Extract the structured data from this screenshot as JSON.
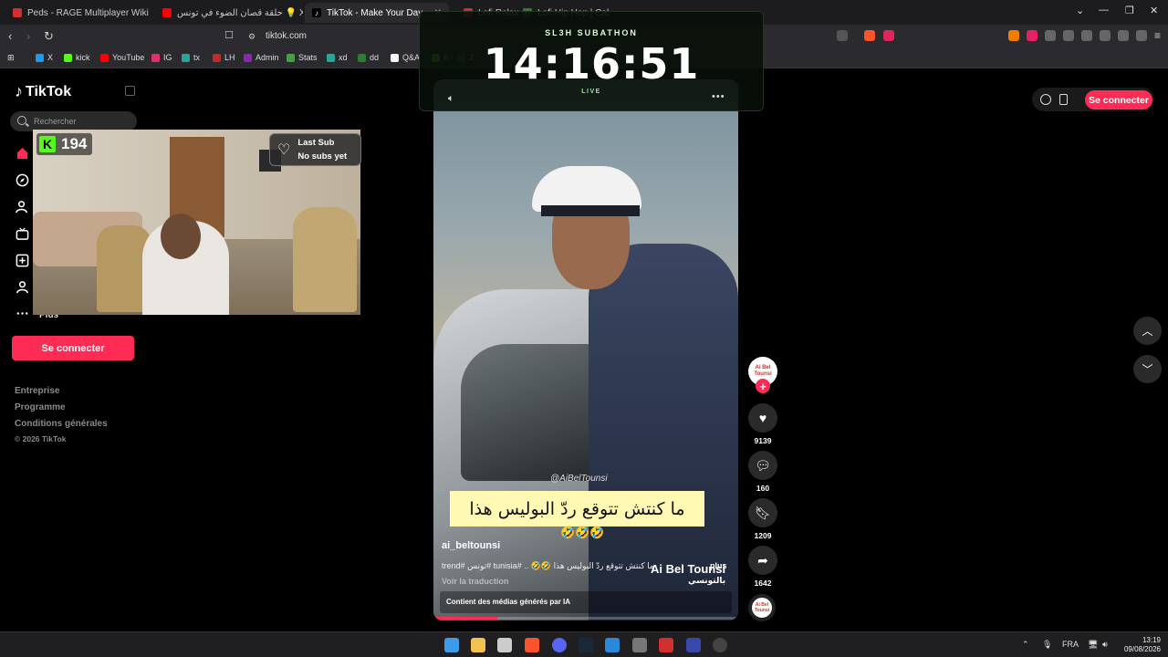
{
  "browser": {
    "tabs": [
      {
        "title": "Peds - RAGE Multiplayer Wiki",
        "favicon_color": "#d32f2f"
      },
      {
        "title": "حلقة قصان الضوء في تونس 💡 X",
        "favicon_color": "#ff0000"
      },
      {
        "title": "TikTok - Make Your Day",
        "favicon_color": "#000000"
      },
      {
        "title": "Lofi Relax",
        "favicon_color": "#d32f2f"
      },
      {
        "title": "Lofi Hip Hop | Cal",
        "favicon_color": "#2e7d32"
      }
    ],
    "active_tab_index": 2,
    "url": "tiktok.com",
    "bookmarks": [
      {
        "label": "X",
        "color": "#1d9bf0"
      },
      {
        "label": "kick",
        "color": "#53fc18"
      },
      {
        "label": "YouTube",
        "color": "#ff0000"
      },
      {
        "label": "IG",
        "color": "#e1306c"
      },
      {
        "label": "tx",
        "color": "#26a69a"
      },
      {
        "label": "LH",
        "color": "#c62828"
      },
      {
        "label": "Admin",
        "color": "#8e24aa"
      },
      {
        "label": "Stats",
        "color": "#43a047"
      },
      {
        "label": "xd",
        "color": "#26a69a"
      },
      {
        "label": "dd",
        "color": "#2e7d32"
      },
      {
        "label": "Q&A",
        "color": "#f5f5f5"
      },
      {
        "label": "K",
        "color": "#53fc18"
      },
      {
        "label": "2",
        "color": "#2e7d32"
      }
    ]
  },
  "tiktok": {
    "logo_text": "TikTok",
    "search_placeholder": "Rechercher",
    "more_label": "Plus",
    "login_button": "Se connecter",
    "footer_links": [
      "Entreprise",
      "Programme",
      "Conditions générales"
    ],
    "copyright": "© 2026 TikTok",
    "top_right_login": "Se connecter"
  },
  "stream_overlay": {
    "kick_count": "194",
    "last_sub_title": "Last Sub",
    "last_sub_value": "No subs yet",
    "subathon_title": "SL3H SUBATHON",
    "subathon_timer": "14:16:51",
    "subathon_status": "LIVE"
  },
  "video": {
    "watermark": "@AiBelTounsi",
    "caption": "ما كنتش تتوقع ردّ البوليس هذا",
    "caption_emojis": "🤣🤣🤣",
    "author": "ai_beltounsi",
    "description": "ما كنتش تتوقع ردّ البوليس هذا 🤣🤣 .. #tunisia #تونس #trend",
    "more": "plus",
    "translate": "Voir la traduction",
    "ai_notice": "Contient des médias générés par IA",
    "channel_logo": "Ai Bel Tounsi",
    "channel_logo_sub": "بالتونسي",
    "progress_percent": 21,
    "likes": "9139",
    "comments": "160",
    "saves": "1209",
    "shares": "1642"
  },
  "taskbar": {
    "language": "FRA",
    "time": "13:19",
    "date": "09/08/2026"
  },
  "colors": {
    "tiktok_red": "#fe2c55",
    "kick_green": "#53fc18"
  }
}
